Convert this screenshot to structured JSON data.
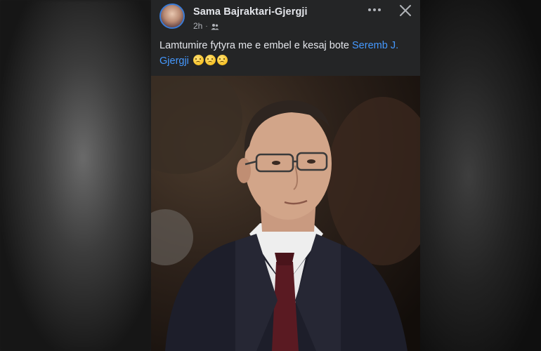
{
  "post": {
    "author": "Sama Bajraktari-Gjergji",
    "time": "2h",
    "separator": "·",
    "audience_icon": "friends-icon",
    "caption_text": "Lamtumire fytyra me e embel e kesaj bote ",
    "tagged_name": "Seremb J. Gjergji",
    "emojis": [
      "crying-face",
      "crying-face",
      "crying-face"
    ],
    "photo_description_icon": "portrait-photo"
  },
  "colors": {
    "card_background": "#242526",
    "text_primary": "#e4e6eb",
    "text_secondary": "#b0b3b8",
    "link": "#4599ff"
  }
}
